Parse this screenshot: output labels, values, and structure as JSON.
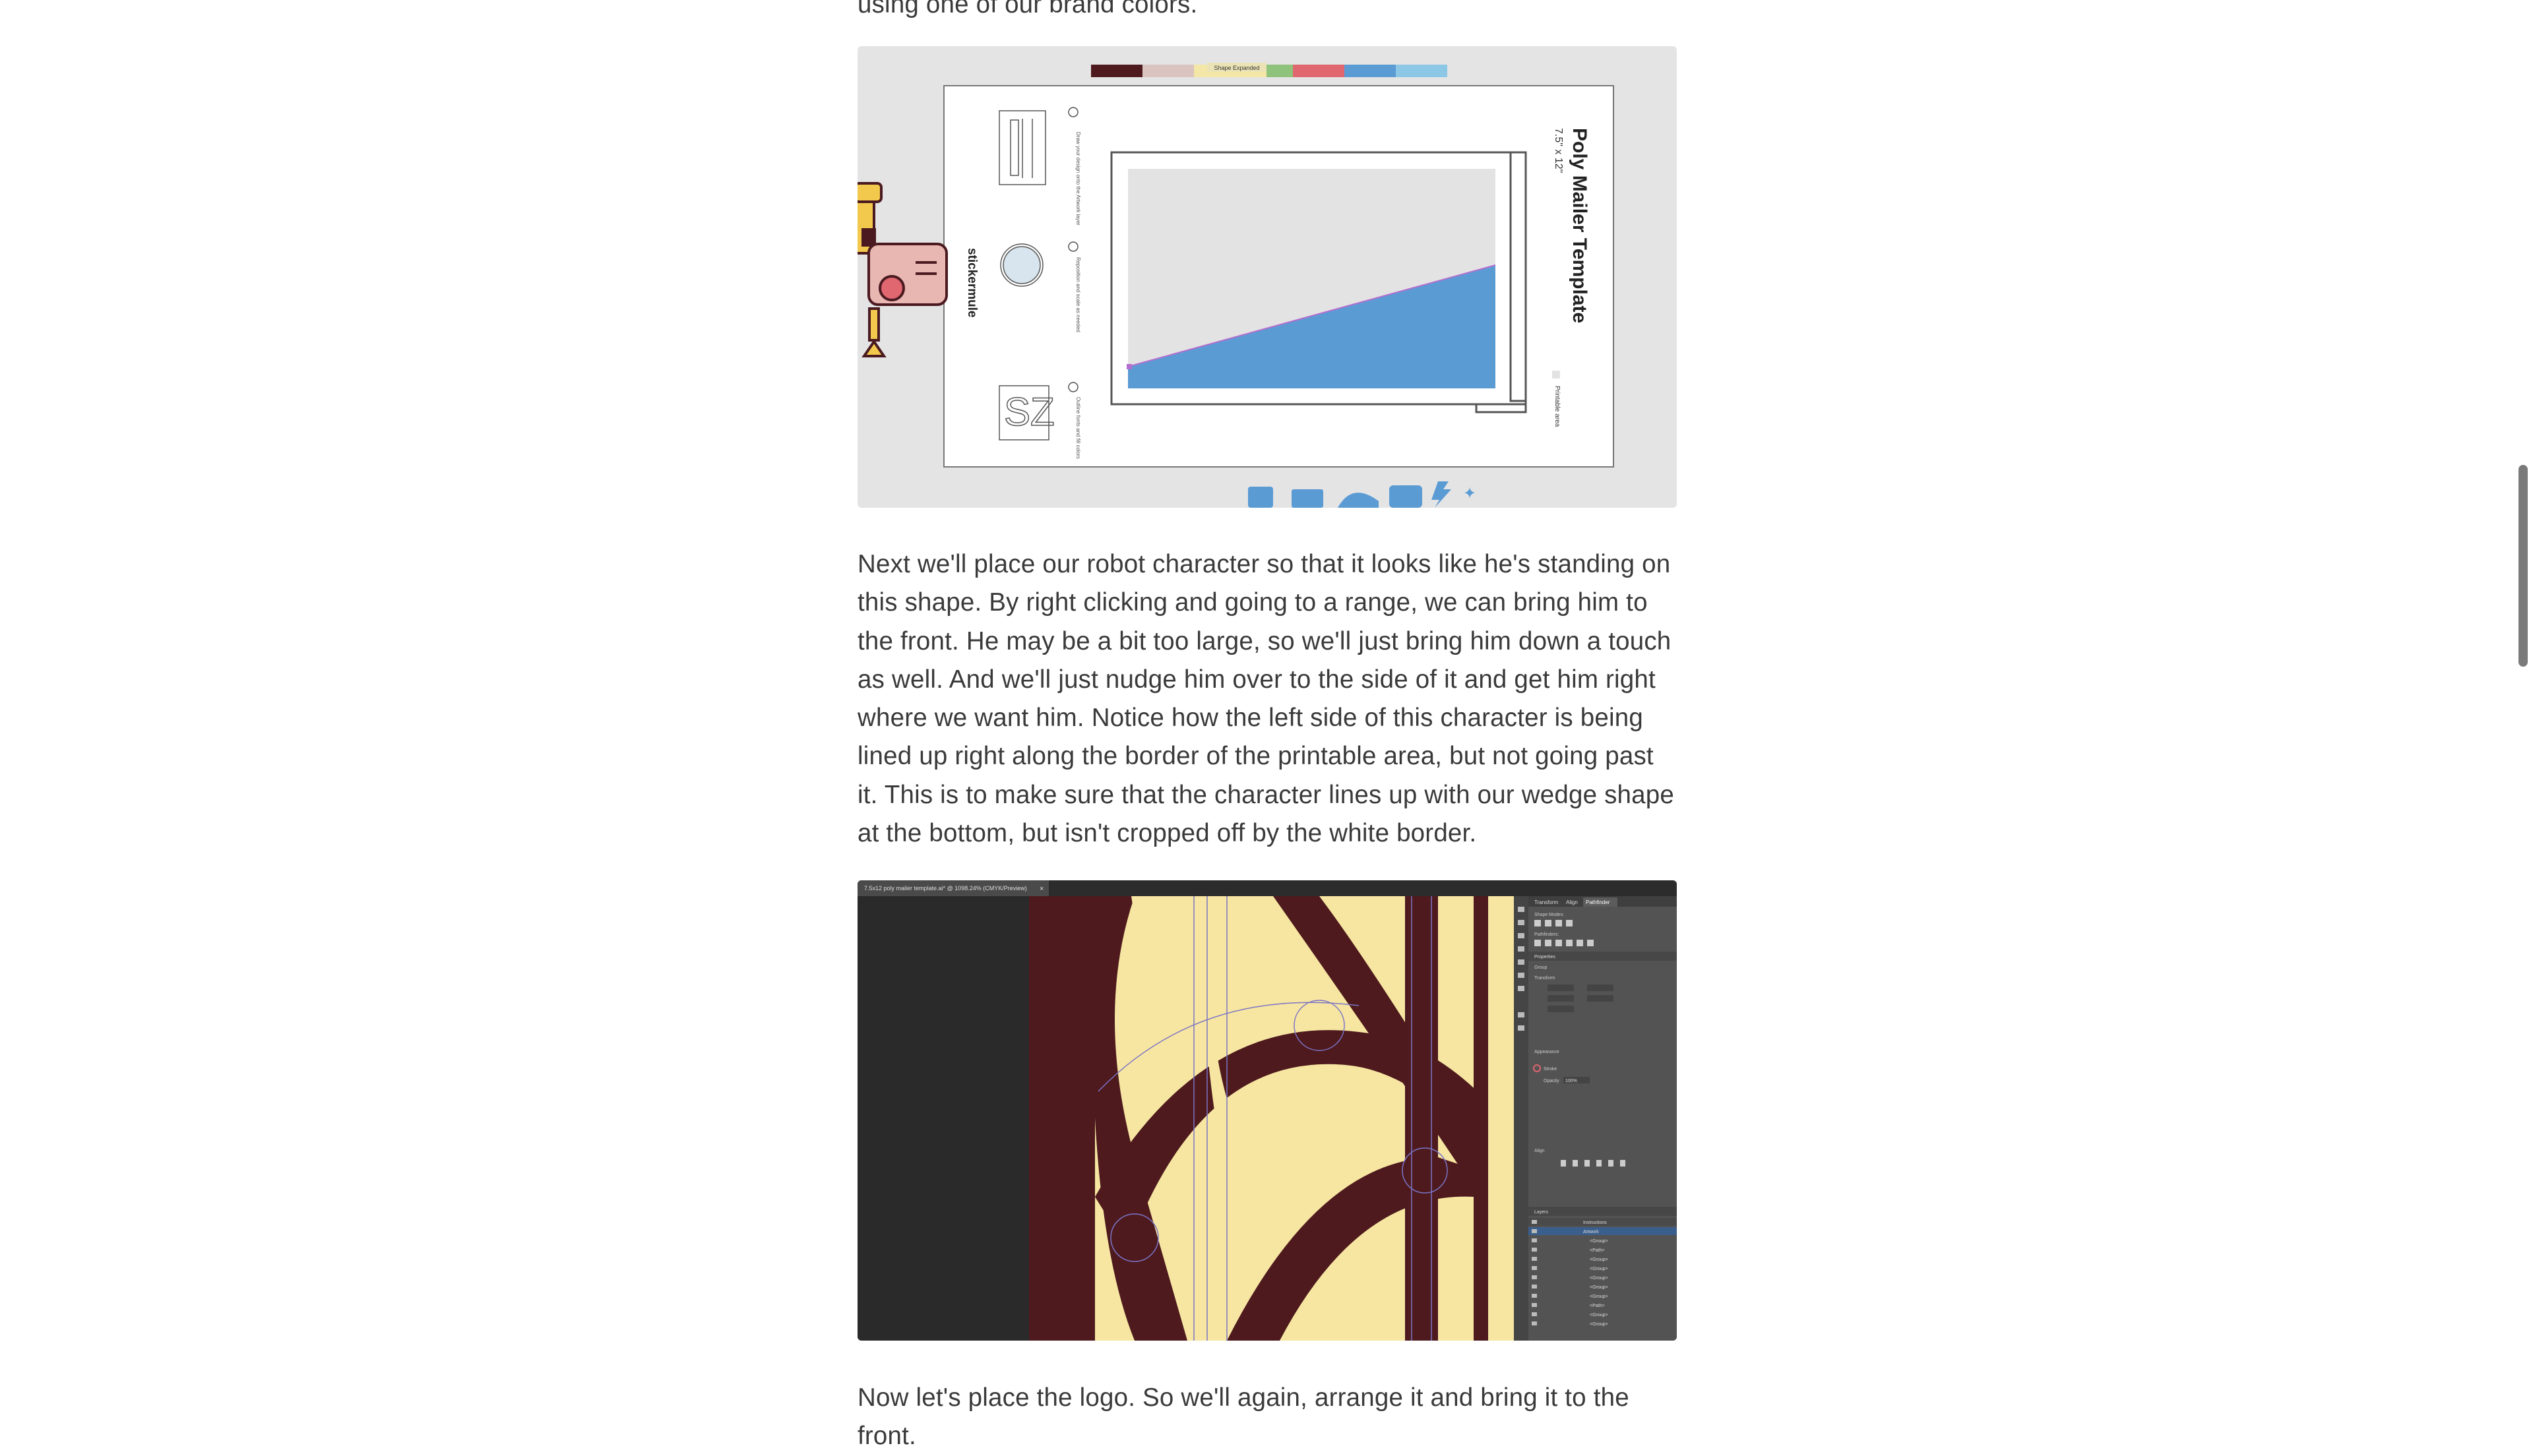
{
  "article": {
    "top_fragment": "using one of our brand colors.",
    "para1": "Next we'll place our robot character so that it looks like he's standing on this shape. By right clicking and going to a range, we can bring him to the front. He may be a bit too large, so we'll just bring him down a touch as well. And we'll just nudge him over to the side of it and get him right where we want him. Notice how the left side of this character is being lined up right along the border of the printable area, but not going past it. This is to make sure that the character lines up with our wedge shape at the bottom, but isn't cropped off by the white border.",
    "para2": "Now let's place the logo. So we'll again, arrange it and bring it to the front."
  },
  "figure1": {
    "title": "Poly Mailer Template",
    "size": "7.5\" x 12\"",
    "brand": "stickermule",
    "printable_area": "Printable area",
    "swatch_label": "Shape Expanded",
    "swatches": [
      "#4e1a1e",
      "#d9c4c0",
      "#f3e6a6",
      "#8fc27a",
      "#e06670",
      "#5b9bd4",
      "#8cc8e6"
    ]
  },
  "figure2": {
    "tab_title": "7.5x12 poly mailer template.ai* @ 1098.24% (CMYK/Preview)",
    "panel_tabs": [
      "Transform",
      "Align",
      "Pathfinder"
    ],
    "sections": [
      "Shape Modes:",
      "Pathfinders:",
      "Properties",
      "Group",
      "Transform",
      "Appearance",
      "Stroke",
      "Opacity",
      "Align",
      "Layers"
    ],
    "opacity_value": "100%",
    "layer_names": [
      "Instructions",
      "Artwork",
      "<Group>",
      "<Path>",
      "<Group>",
      "<Group>",
      "<Group>",
      "<Group>",
      "<Group>",
      "<Path>",
      "<Group>",
      "<Group>"
    ]
  }
}
